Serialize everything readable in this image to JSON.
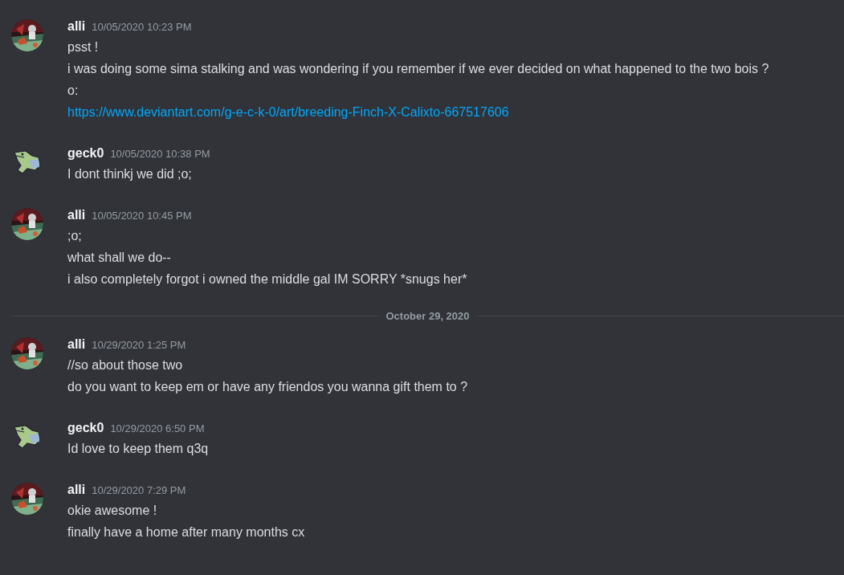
{
  "messages": [
    {
      "author": "alli",
      "avatar": {
        "kind": "picture"
      },
      "timestamp": "10/05/2020 10:23 PM",
      "lines": [
        {
          "kind": "text",
          "text": "psst !"
        },
        {
          "kind": "text",
          "text": "i was doing some sima stalking and was wondering if you remember if we ever decided on what happened to the two bois ? o:"
        },
        {
          "kind": "link",
          "text": "https://www.deviantart.com/g-e-c-k-0/art/breeding-Finch-X-Calixto-667517606"
        }
      ]
    },
    {
      "author": "geck0",
      "avatar": {
        "kind": "lizard"
      },
      "timestamp": "10/05/2020 10:38 PM",
      "lines": [
        {
          "kind": "text",
          "text": "I dont thinkj we did ;o;"
        }
      ]
    },
    {
      "author": "alli",
      "avatar": {
        "kind": "picture"
      },
      "timestamp": "10/05/2020 10:45 PM",
      "lines": [
        {
          "kind": "text",
          "text": ";o;"
        },
        {
          "kind": "text",
          "text": "what shall we do--"
        },
        {
          "kind": "text",
          "text": "i also completely forgot i owned the middle gal IM SORRY *snugs her*"
        }
      ]
    },
    {
      "kind": "divider",
      "date": "October 29, 2020"
    },
    {
      "author": "alli",
      "avatar": {
        "kind": "picture"
      },
      "timestamp": "10/29/2020 1:25 PM",
      "lines": [
        {
          "kind": "text",
          "text": "//so about those two"
        },
        {
          "kind": "text",
          "text": "do you want to keep em or have any friendos you wanna gift them to ?"
        }
      ]
    },
    {
      "author": "geck0",
      "avatar": {
        "kind": "lizard"
      },
      "timestamp": "10/29/2020 6:50 PM",
      "lines": [
        {
          "kind": "text",
          "text": "Id love to keep them q3q"
        }
      ]
    },
    {
      "author": "alli",
      "avatar": {
        "kind": "picture"
      },
      "timestamp": "10/29/2020 7:29 PM",
      "lines": [
        {
          "kind": "text",
          "text": "okie awesome !"
        },
        {
          "kind": "text",
          "text": "finally have a home after many months cx"
        }
      ]
    }
  ]
}
